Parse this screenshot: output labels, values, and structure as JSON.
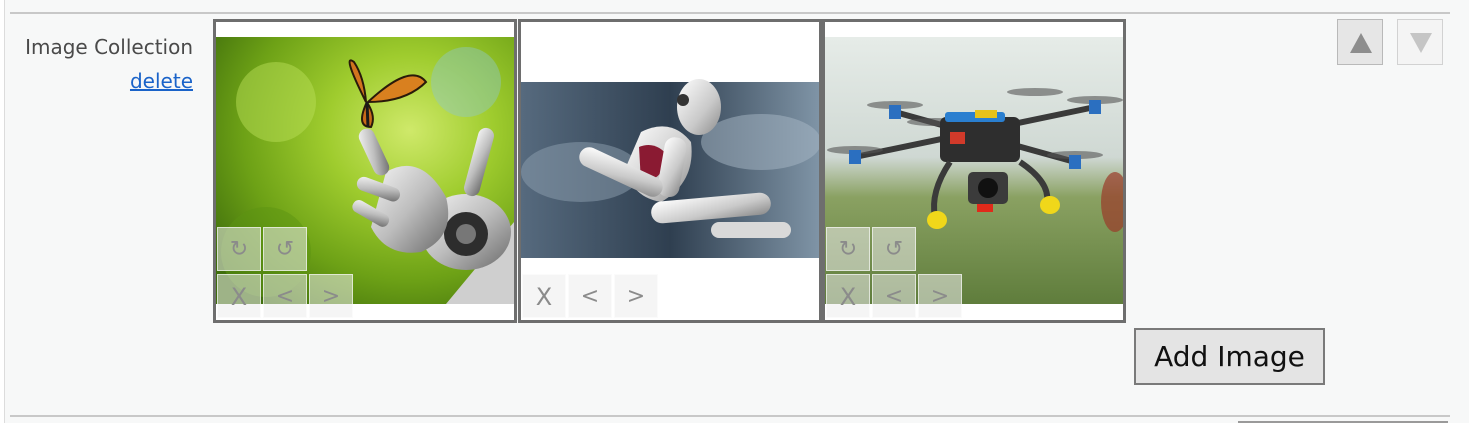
{
  "field": {
    "label": "Image Collection",
    "delete_label": "delete"
  },
  "images": [
    {
      "subject": "robot hand holding butterfly",
      "tools": {
        "rotate_cw": "↻",
        "rotate_ccw": "↺",
        "delete": "X",
        "prev": "<",
        "next": ">"
      }
    },
    {
      "subject": "thinking robot",
      "tools": {
        "delete": "X",
        "prev": "<",
        "next": ">"
      }
    },
    {
      "subject": "quadcopter drone",
      "tools": {
        "rotate_cw": "↻",
        "rotate_ccw": "↺",
        "delete": "X",
        "prev": "<",
        "next": ">"
      }
    }
  ],
  "controls": {
    "add_image_label": "Add Image",
    "move_up_icon": "triangle-up-icon",
    "move_down_icon": "triangle-down-icon"
  },
  "colors": {
    "link": "#1a63c9",
    "thumb_border": "#6e6e6e",
    "panel_bg": "#f7f8f8"
  }
}
